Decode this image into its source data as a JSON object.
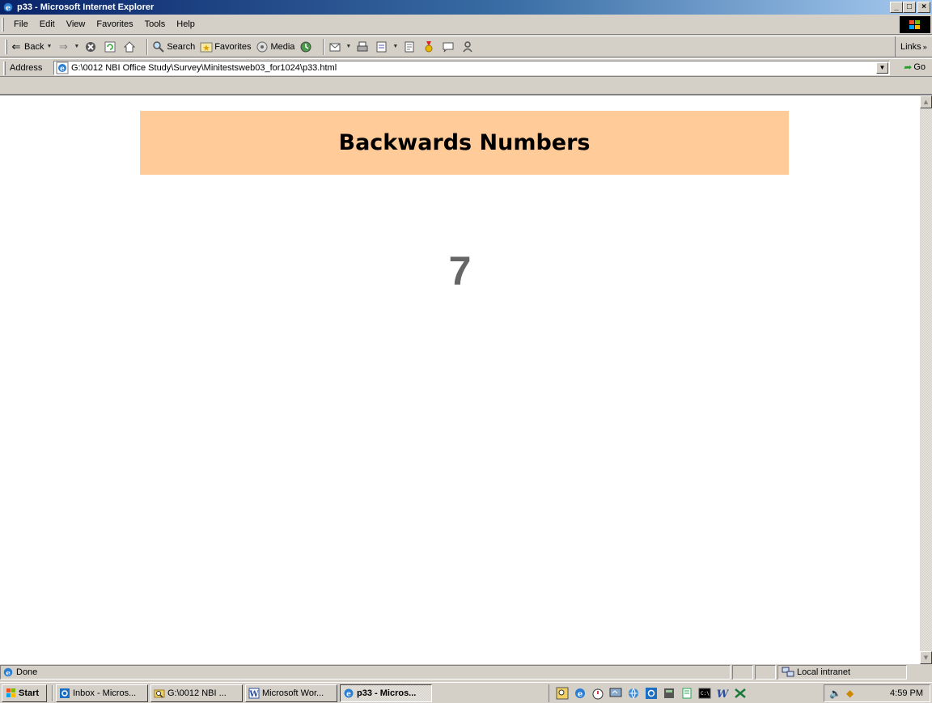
{
  "window": {
    "title": "p33 - Microsoft Internet Explorer",
    "min_label": "_",
    "max_label": "□",
    "close_label": "×"
  },
  "menu": {
    "items": [
      "File",
      "Edit",
      "View",
      "Favorites",
      "Tools",
      "Help"
    ]
  },
  "toolbar": {
    "back_label": "Back",
    "search_label": "Search",
    "favorites_label": "Favorites",
    "media_label": "Media",
    "links_label": "Links"
  },
  "address": {
    "label": "Address",
    "url": "G:\\0012 NBI Office Study\\Survey\\Minitestsweb03_for1024\\p33.html",
    "go_label": "Go"
  },
  "page": {
    "heading": "Backwards Numbers",
    "number": "7",
    "banner_color": "#ffcc99",
    "number_color": "#666666"
  },
  "status": {
    "text": "Done",
    "zone": "Local intranet"
  },
  "taskbar": {
    "start_label": "Start",
    "tasks": [
      {
        "label": "Inbox - Micros...",
        "icon": "outlook-icon"
      },
      {
        "label": "G:\\0012 NBI ...",
        "icon": "folder-search-icon"
      },
      {
        "label": "Microsoft Wor...",
        "icon": "word-icon"
      },
      {
        "label": "p33 - Micros...",
        "icon": "ie-icon",
        "active": true
      }
    ],
    "clock": "4:59 PM"
  }
}
